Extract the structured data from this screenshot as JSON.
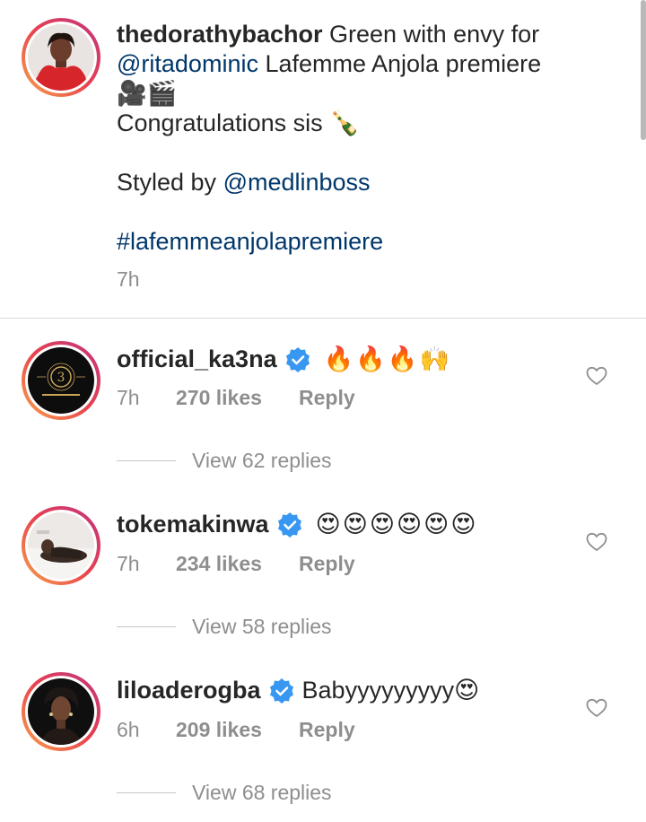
{
  "caption": {
    "username": "thedorathybachor",
    "text_1": " Green with envy for ",
    "mention_1": "@ritadominic",
    "text_2": " Lafemme Anjola premiere",
    "emoji_line": "🎥🎬",
    "congrats": "Congratulations sis 🍾",
    "styled_prefix": "Styled by ",
    "mention_2": "@medlinboss",
    "hashtag": "#lafemmeanjolapremiere",
    "time": "7h"
  },
  "comments": [
    {
      "username": "official_ka3na",
      "verified": true,
      "text": "🔥🔥🔥🙌",
      "time": "7h",
      "likes": "270 likes",
      "reply": "Reply",
      "view_replies": "View 62 replies",
      "avatar_icon": "ka3na-logo-avatar"
    },
    {
      "username": "tokemakinwa",
      "verified": true,
      "text": "😍😍😍😍😍😍",
      "time": "7h",
      "likes": "234 likes",
      "reply": "Reply",
      "view_replies": "View 58 replies",
      "avatar_icon": "person-photo-avatar"
    },
    {
      "username": "liloaderogba",
      "verified": true,
      "text": "Babyyyyyyyyy😍",
      "time": "6h",
      "likes": "209 likes",
      "reply": "Reply",
      "view_replies": "View 68 replies",
      "avatar_icon": "person-photo-avatar"
    }
  ],
  "colors": {
    "mention": "#00376b",
    "verified": "#3897f0",
    "muted": "#8e8e8e",
    "text": "#262626"
  }
}
